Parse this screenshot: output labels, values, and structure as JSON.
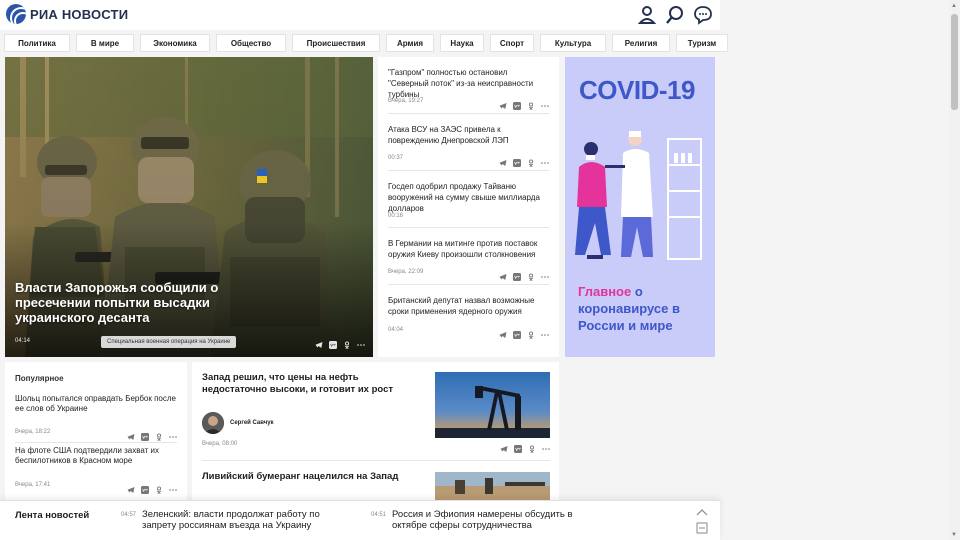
{
  "header": {
    "logo_text": "РИА НОВОСТИ",
    "icons": [
      "user-icon",
      "search-icon",
      "chat-icon"
    ]
  },
  "nav": {
    "items": [
      "Политика",
      "В мире",
      "Экономика",
      "Общество",
      "Происшествия",
      "Армия",
      "Наука",
      "Спорт",
      "Культура",
      "Религия",
      "Туризм"
    ]
  },
  "hero": {
    "title": "Власти Запорожья сообщили о пресечении попытки высадки украинского десанта",
    "time": "04:14",
    "tag": "Специальная военная операция на Украине"
  },
  "feed": {
    "items": [
      {
        "title": "\"Газпром\" полностью остановил \"Северный поток\" из-за неисправности турбины",
        "time": "Вчера, 19:27"
      },
      {
        "title": "Атака ВСУ на ЗАЭС привела к повреждению Днепровской ЛЭП",
        "time": "00:37"
      },
      {
        "title": "Госдеп одобрил продажу Тайваню вооружений на сумму свыше миллиарда долларов",
        "time": "00:16"
      },
      {
        "title": "В Германии на митинге против поставок оружия Киеву произошли столкновения",
        "time": "Вчера, 22:09"
      },
      {
        "title": "Британский депутат назвал возможные сроки применения ядерного оружия",
        "time": "04:04"
      }
    ]
  },
  "ad": {
    "title": "COVID-19",
    "caption_accent": "Главное",
    "caption_rest": "о коронавирусе в России и мире",
    "colors": {
      "background": "#c9cbf9",
      "title": "#3e57c9",
      "accent": "#e4339a"
    }
  },
  "popular": {
    "heading": "Популярное",
    "items": [
      {
        "title": "Шольц попытался оправдать Бербок после ее слов об Украине",
        "time": "Вчера, 18:22"
      },
      {
        "title": "На флоте США подтвердили захват их беспилотников в Красном море",
        "time": "Вчера, 17:41"
      }
    ]
  },
  "articles": {
    "items": [
      {
        "title": "Запад решил, что цены на нефть недостаточно высоки, и готовит их рост",
        "author": "Сергей Савчук",
        "time": "Вчера, 08:00"
      },
      {
        "title": "Ливийский бумеранг нацелился на Запад"
      }
    ]
  },
  "bottom_bar": {
    "label": "Лента новостей",
    "news": [
      {
        "time": "04:57",
        "text": "Зеленский: власти продолжат работу по запрету россиянам въезда на Украину"
      },
      {
        "time": "04:51",
        "text": "Россия и Эфиопия намерены обсудить в октябре сферы сотрудничества"
      }
    ]
  },
  "share_icons": [
    "telegram-icon",
    "vk-icon",
    "ok-icon",
    "more-icon"
  ]
}
